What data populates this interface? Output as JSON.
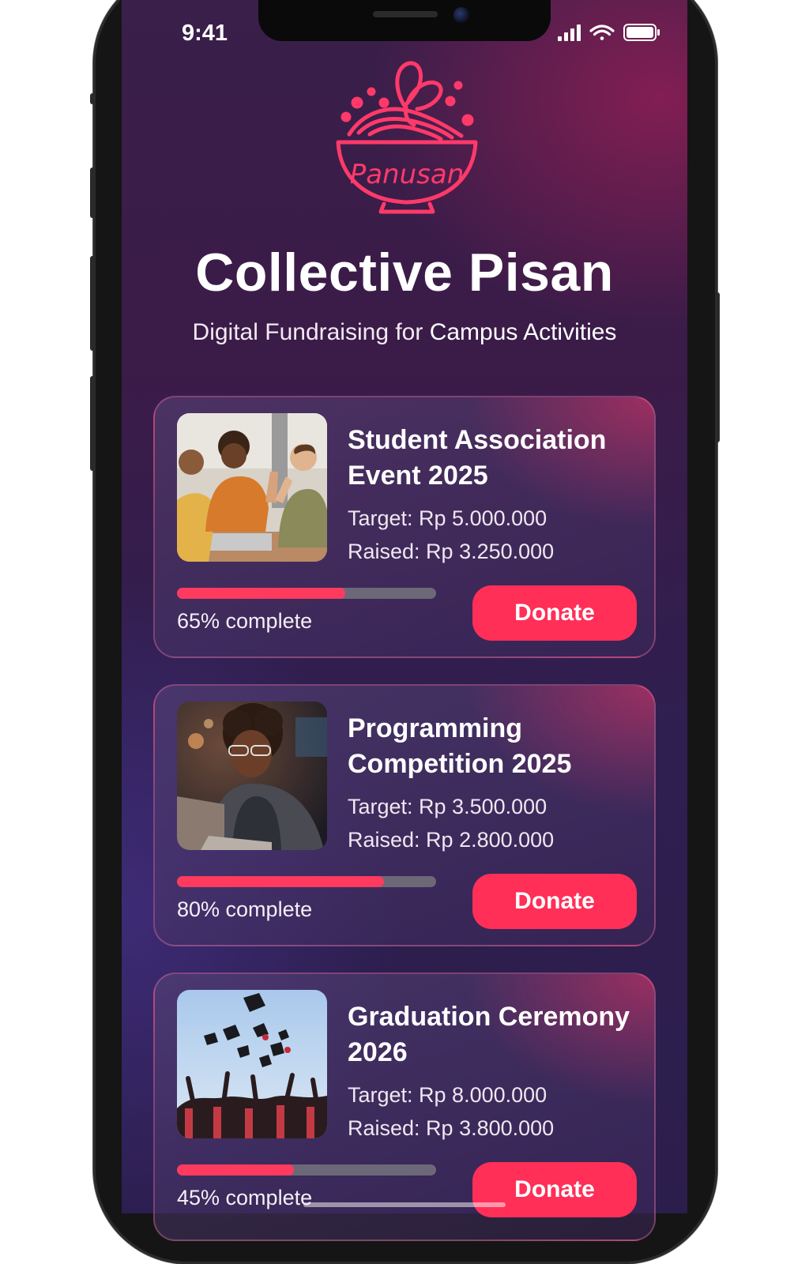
{
  "status_bar": {
    "time": "9:41",
    "icons": [
      "signal-icon",
      "wifi-icon",
      "battery-icon"
    ]
  },
  "logo": {
    "text": "Panusan",
    "color": "#ff3a6a"
  },
  "header": {
    "title": "Collective Pisan",
    "subtitle_prefix": "Digital Fundraising for",
    "subtitle_emphasis": "Campus Activities"
  },
  "campaigns": [
    {
      "title": "Student Association Event 2025",
      "target": "Target: Rp 5.000.000",
      "raised": "Raised: Rp 3.250.000",
      "progress": 0.65,
      "progress_label": "65% complete",
      "donate_label": "Donate",
      "image": "students-high-five-photo"
    },
    {
      "title": "Programming Competition 2025",
      "target": "Target: Rp 3.500.000",
      "raised": "Raised: Rp 2.800.000",
      "progress": 0.8,
      "progress_label": "80% complete",
      "donate_label": "Donate",
      "image": "student-laptop-photo"
    },
    {
      "title": "Graduation Ceremony 2026",
      "target": "Target: Rp 8.000.000",
      "raised": "Raised: Rp 3.800.000",
      "progress": 0.45,
      "progress_label": "45% complete",
      "donate_label": "Donate",
      "image": "graduation-caps-photo"
    }
  ],
  "colors": {
    "accent": "#ff2f58",
    "background_top": "#3a1f4a",
    "background_bottom": "#2b1d4c"
  }
}
